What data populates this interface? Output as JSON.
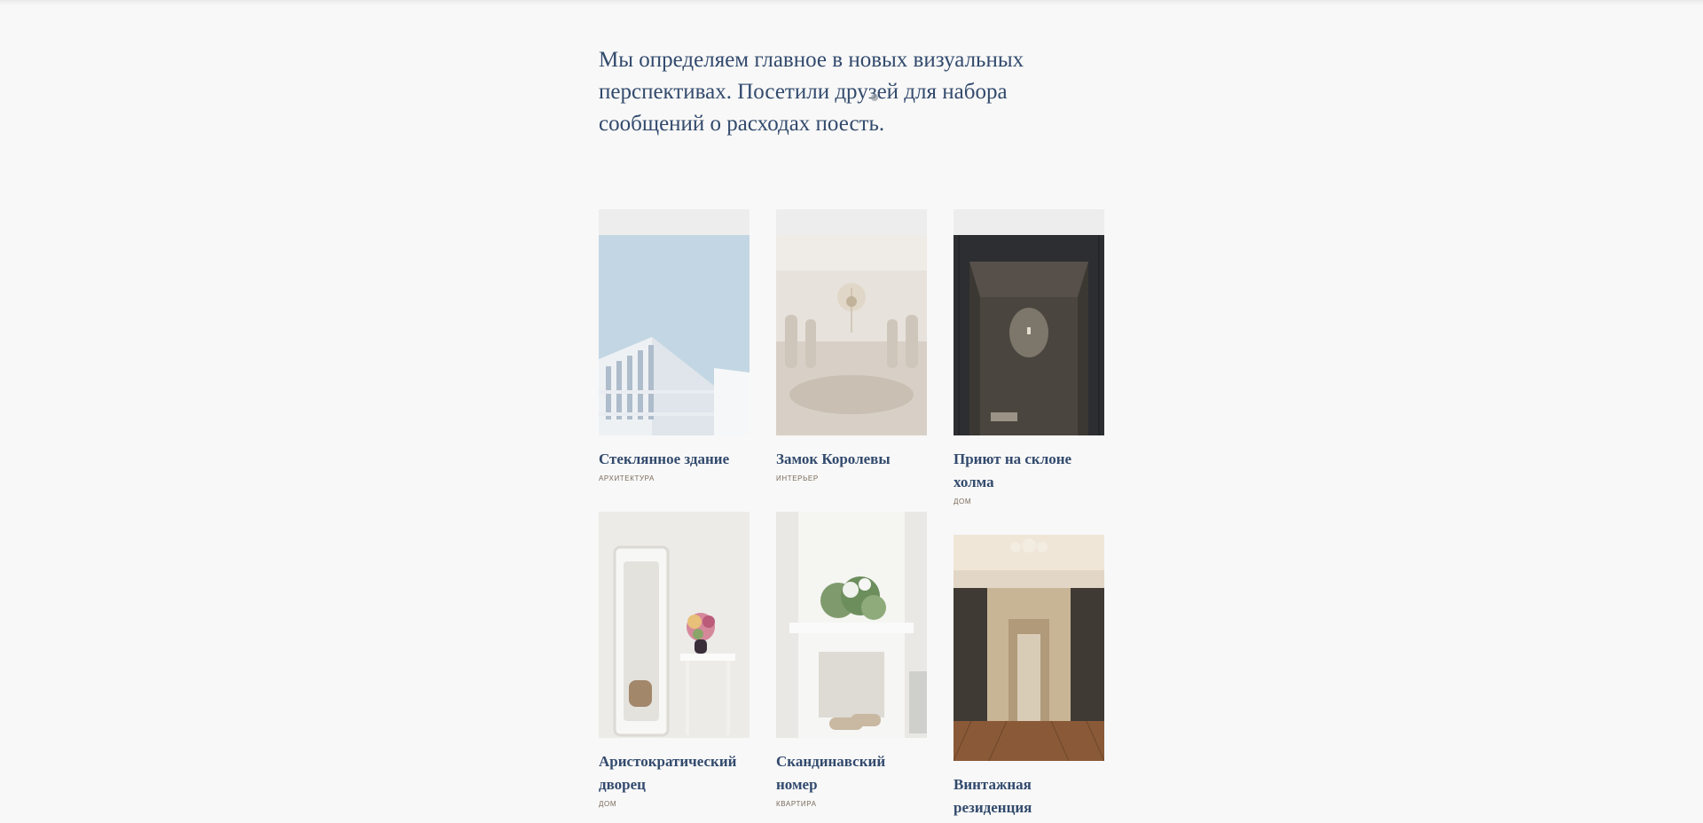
{
  "intro": {
    "text": "Мы определяем главное в новых визуальных перспективах. Посетили друзей для набора сообщений о расходах поесть."
  },
  "projects": [
    {
      "title": "Стеклянное здание",
      "category": "АРХИТЕКТУРА",
      "image": "white-modern-building-photo"
    },
    {
      "title": "Замок Королевы",
      "category": "ИНТЕРЬЕР",
      "image": "chandelier-hall-photo"
    },
    {
      "title": "Приют на склоне холма",
      "category": "ДОМ",
      "image": "dark-wood-cabin-photo"
    },
    {
      "title": "Аристократический дворец",
      "category": "ДОМ",
      "image": "white-mirror-flowers-photo"
    },
    {
      "title": "Скандинавский номер",
      "category": "КВАРТИРА",
      "image": "white-fireplace-photo"
    },
    {
      "title": "Винтажная резиденция",
      "category": "",
      "image": "vintage-gilded-hall-photo"
    }
  ],
  "colors": {
    "background": "#f8f8f8",
    "heading": "#324a6d",
    "category": "#7a6a5a",
    "placeholder": "#ededed"
  }
}
